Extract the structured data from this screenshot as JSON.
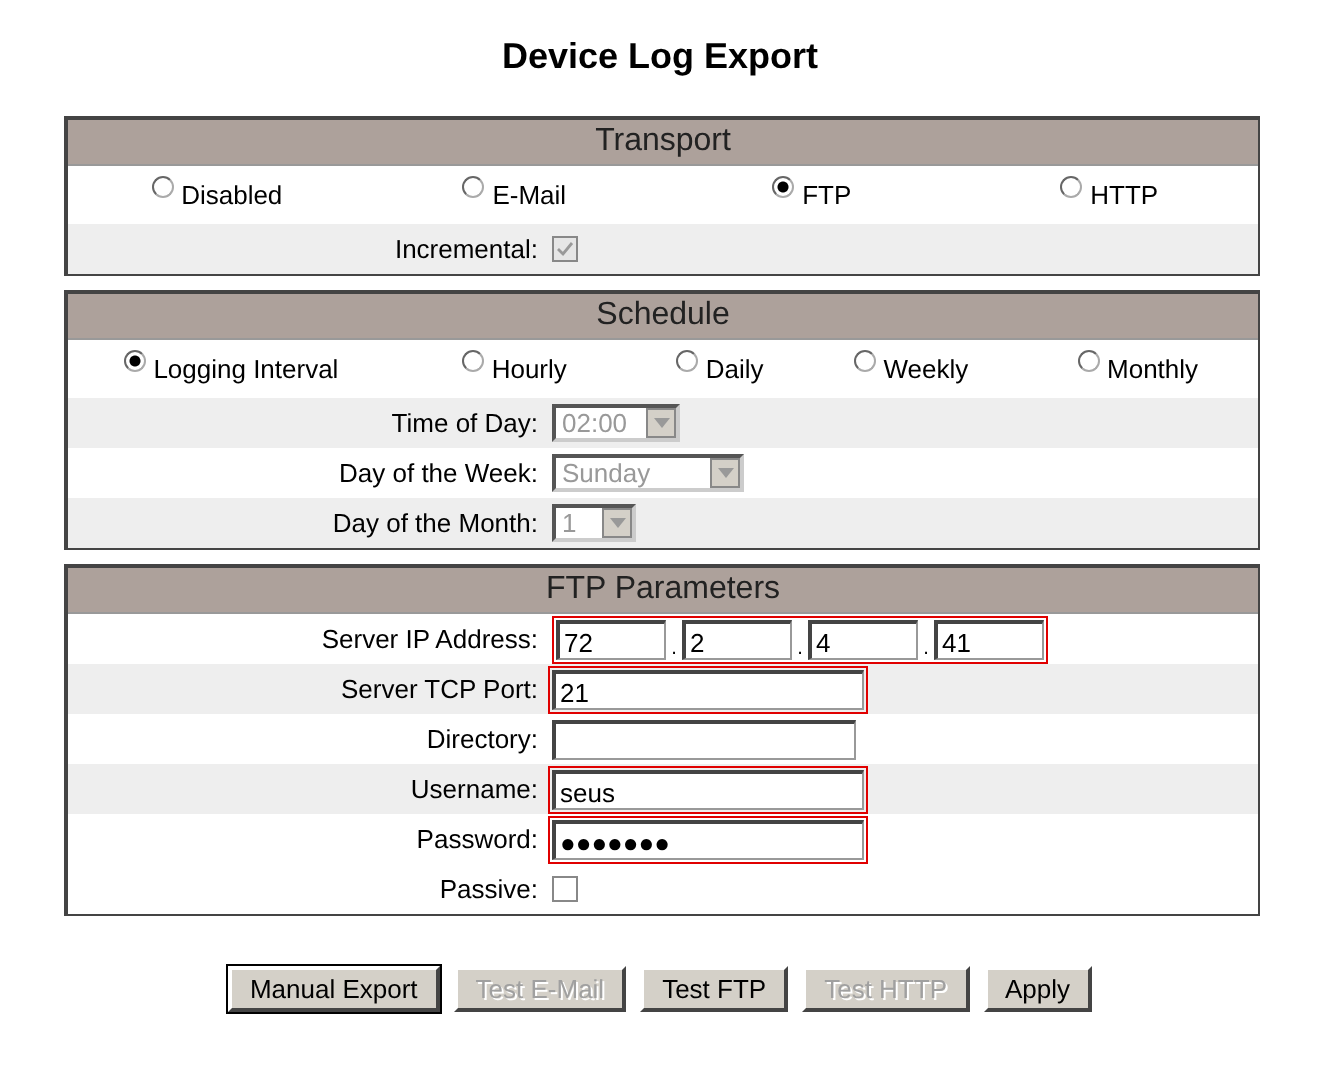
{
  "title": "Device Log Export",
  "transport": {
    "title": "Transport",
    "options": [
      {
        "label": "Disabled",
        "selected": false
      },
      {
        "label": "E-Mail",
        "selected": false
      },
      {
        "label": "FTP",
        "selected": true
      },
      {
        "label": "HTTP",
        "selected": false
      }
    ],
    "incremental": {
      "label": "Incremental:",
      "checked": true,
      "disabled": true
    }
  },
  "schedule": {
    "title": "Schedule",
    "options": [
      {
        "label": "Logging Interval",
        "selected": true
      },
      {
        "label": "Hourly",
        "selected": false
      },
      {
        "label": "Daily",
        "selected": false
      },
      {
        "label": "Weekly",
        "selected": false
      },
      {
        "label": "Monthly",
        "selected": false
      }
    ],
    "fields": [
      {
        "label": "Time of Day:",
        "value": "02:00",
        "disabled": true
      },
      {
        "label": "Day of the Week:",
        "value": "Sunday",
        "disabled": true
      },
      {
        "label": "Day of the Month:",
        "value": "1",
        "disabled": true
      }
    ]
  },
  "ftp": {
    "title": "FTP Parameters",
    "fields": [
      {
        "kind": "ip",
        "label": "Server IP Address:",
        "octets": [
          "72",
          "2",
          "4",
          "41"
        ],
        "separators": [
          ".",
          ".",
          "."
        ],
        "error": true
      },
      {
        "kind": "text",
        "label": "Server TCP Port:",
        "value": "21",
        "error": true
      },
      {
        "kind": "text",
        "label": "Directory:",
        "error": false
      },
      {
        "kind": "text",
        "label": "Username:",
        "value": "seus",
        "error": true
      },
      {
        "kind": "text",
        "label": "Password:",
        "value": "●●●●●●●",
        "error": true
      }
    ],
    "passive": {
      "label": "Passive:",
      "checked": false
    }
  },
  "buttons": [
    {
      "label": "Manual Export",
      "disabled": false,
      "default": true
    },
    {
      "label": "Test E-Mail",
      "disabled": true,
      "default": false
    },
    {
      "label": "Test FTP",
      "disabled": false,
      "default": false
    },
    {
      "label": "Test HTTP",
      "disabled": true,
      "default": false
    },
    {
      "label": "Apply",
      "disabled": false,
      "default": false
    }
  ]
}
